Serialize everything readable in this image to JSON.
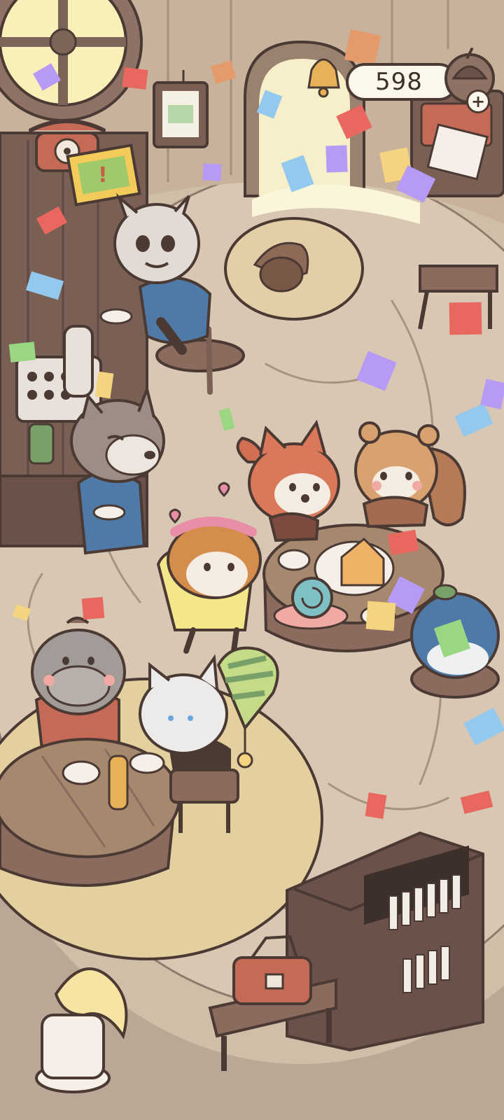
{
  "hud": {
    "coins": "598",
    "coin_icon": "acorn-coin-icon",
    "add_button_icon": "plus-icon"
  },
  "scene": {
    "name": "animal-cafe-party",
    "characters": [
      "goat",
      "wolf",
      "fox",
      "squirrel",
      "shiba-dog",
      "snail",
      "blue-bird",
      "hippo",
      "white-cat"
    ],
    "objects": [
      "round-window",
      "telephone",
      "poster",
      "framed-picture",
      "door-bell",
      "arched-door",
      "acorn-rug",
      "record-stand",
      "cash-register",
      "round-table-center",
      "round-table-left",
      "stool",
      "party-hat",
      "bookshelf",
      "toolbox",
      "stool-small",
      "cake",
      "drink-bottle",
      "lamp-vase"
    ]
  },
  "colors": {
    "floor": "#d8c7b2",
    "floor_ring": "#e6d6bd",
    "rug": "#e9d3a8",
    "wall": "#cdb7a0",
    "wood": "#7a5f55",
    "outline": "#4a3a33",
    "coin_pill": "#fbf7ec",
    "confetti": [
      "#b79af5",
      "#e8675e",
      "#93c8ef",
      "#f4d480",
      "#9ad782",
      "#e59a6b"
    ]
  }
}
